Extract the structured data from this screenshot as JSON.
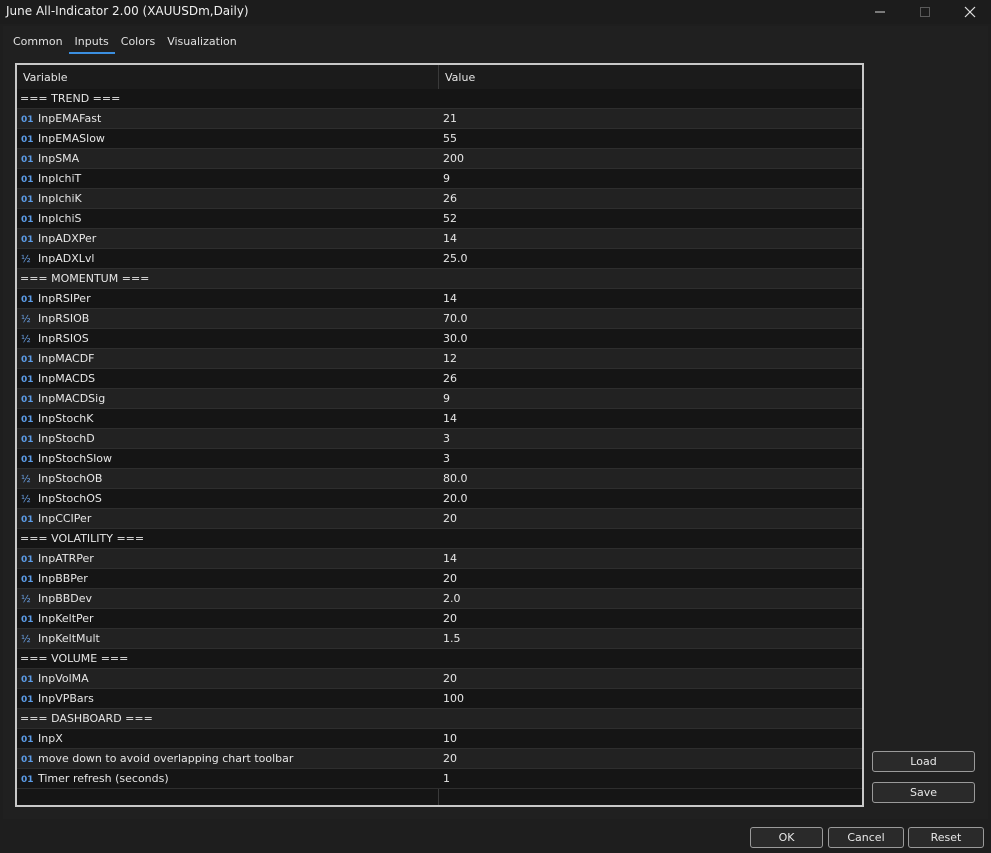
{
  "window": {
    "title": "June All-Indicator 2.00 (XAUUSDm,Daily)"
  },
  "tabs": [
    {
      "label": "Common",
      "active": false
    },
    {
      "label": "Inputs",
      "active": true
    },
    {
      "label": "Colors",
      "active": false
    },
    {
      "label": "Visualization",
      "active": false
    }
  ],
  "table": {
    "headers": {
      "variable": "Variable",
      "value": "Value"
    },
    "rows": [
      {
        "type": "section",
        "name": "=== TREND ===",
        "value": ""
      },
      {
        "type": "int",
        "name": "InpEMAFast",
        "value": "21"
      },
      {
        "type": "int",
        "name": "InpEMASlow",
        "value": "55"
      },
      {
        "type": "int",
        "name": "InpSMA",
        "value": "200"
      },
      {
        "type": "int",
        "name": "InpIchiT",
        "value": "9"
      },
      {
        "type": "int",
        "name": "InpIchiK",
        "value": "26"
      },
      {
        "type": "int",
        "name": "InpIchiS",
        "value": "52"
      },
      {
        "type": "int",
        "name": "InpADXPer",
        "value": "14"
      },
      {
        "type": "double",
        "name": "InpADXLvl",
        "value": "25.0"
      },
      {
        "type": "section",
        "name": "=== MOMENTUM ===",
        "value": ""
      },
      {
        "type": "int",
        "name": "InpRSIPer",
        "value": "14"
      },
      {
        "type": "double",
        "name": "InpRSIOB",
        "value": "70.0"
      },
      {
        "type": "double",
        "name": "InpRSIOS",
        "value": "30.0"
      },
      {
        "type": "int",
        "name": "InpMACDF",
        "value": "12"
      },
      {
        "type": "int",
        "name": "InpMACDS",
        "value": "26"
      },
      {
        "type": "int",
        "name": "InpMACDSig",
        "value": "9"
      },
      {
        "type": "int",
        "name": "InpStochK",
        "value": "14"
      },
      {
        "type": "int",
        "name": "InpStochD",
        "value": "3"
      },
      {
        "type": "int",
        "name": "InpStochSlow",
        "value": "3"
      },
      {
        "type": "double",
        "name": "InpStochOB",
        "value": "80.0"
      },
      {
        "type": "double",
        "name": "InpStochOS",
        "value": "20.0"
      },
      {
        "type": "int",
        "name": "InpCCIPer",
        "value": "20"
      },
      {
        "type": "section",
        "name": "=== VOLATILITY ===",
        "value": ""
      },
      {
        "type": "int",
        "name": "InpATRPer",
        "value": "14"
      },
      {
        "type": "int",
        "name": "InpBBPer",
        "value": "20"
      },
      {
        "type": "double",
        "name": "InpBBDev",
        "value": "2.0"
      },
      {
        "type": "int",
        "name": "InpKeltPer",
        "value": "20"
      },
      {
        "type": "double",
        "name": "InpKeltMult",
        "value": "1.5"
      },
      {
        "type": "section",
        "name": "=== VOLUME ===",
        "value": ""
      },
      {
        "type": "int",
        "name": "InpVolMA",
        "value": "20"
      },
      {
        "type": "int",
        "name": "InpVPBars",
        "value": "100"
      },
      {
        "type": "section",
        "name": "=== DASHBOARD ===",
        "value": ""
      },
      {
        "type": "int",
        "name": "InpX",
        "value": "10"
      },
      {
        "type": "int",
        "name": "move down to avoid overlapping chart toolbar",
        "value": "20"
      },
      {
        "type": "int",
        "name": "Timer refresh (seconds)",
        "value": "1"
      }
    ]
  },
  "icons": {
    "int": "01",
    "double": "½"
  },
  "buttons": {
    "load": "Load",
    "save": "Save",
    "ok": "OK",
    "cancel": "Cancel",
    "reset": "Reset"
  },
  "colors": {
    "accent": "#3b8fe0",
    "icon": "#5b9be6"
  }
}
